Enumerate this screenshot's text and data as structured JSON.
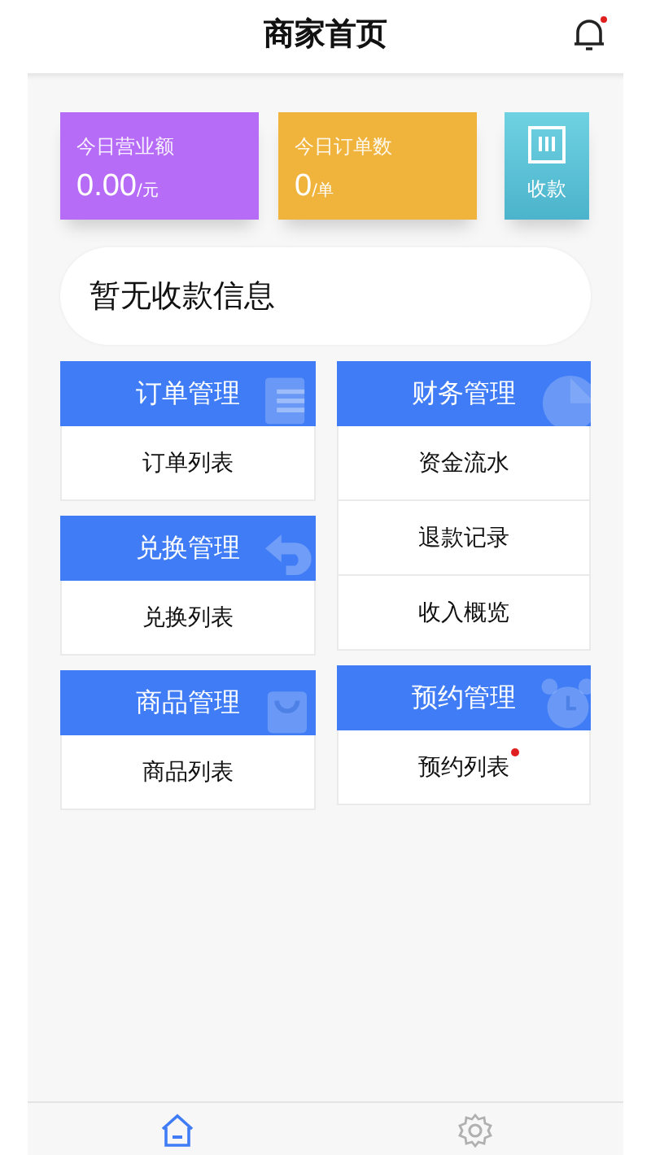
{
  "header": {
    "title": "商家首页",
    "notification": {
      "badge": true
    }
  },
  "stats": [
    {
      "label": "今日营业额",
      "value": "0.00",
      "unit": "/元",
      "color": "#b66cf6"
    },
    {
      "label": "今日订单数",
      "value": "0",
      "unit": "/单",
      "color": "#f0b43c"
    }
  ],
  "collect_button": {
    "label": "收款"
  },
  "notice": {
    "text": "暂无收款信息"
  },
  "columns": [
    {
      "groups": [
        {
          "title": "订单管理",
          "items": [
            {
              "label": "订单列表",
              "badge": false
            }
          ]
        },
        {
          "title": "兑换管理",
          "items": [
            {
              "label": "兑换列表",
              "badge": false
            }
          ]
        },
        {
          "title": "商品管理",
          "items": [
            {
              "label": "商品列表",
              "badge": false
            }
          ]
        }
      ]
    },
    {
      "groups": [
        {
          "title": "财务管理",
          "items": [
            {
              "label": "资金流水",
              "badge": false
            },
            {
              "label": "退款记录",
              "badge": false
            },
            {
              "label": "收入概览",
              "badge": false
            }
          ]
        },
        {
          "title": "预约管理",
          "items": [
            {
              "label": "预约列表",
              "badge": true
            }
          ]
        }
      ]
    }
  ],
  "tab_bar": [
    {
      "selected": true
    },
    {
      "selected": false
    }
  ]
}
